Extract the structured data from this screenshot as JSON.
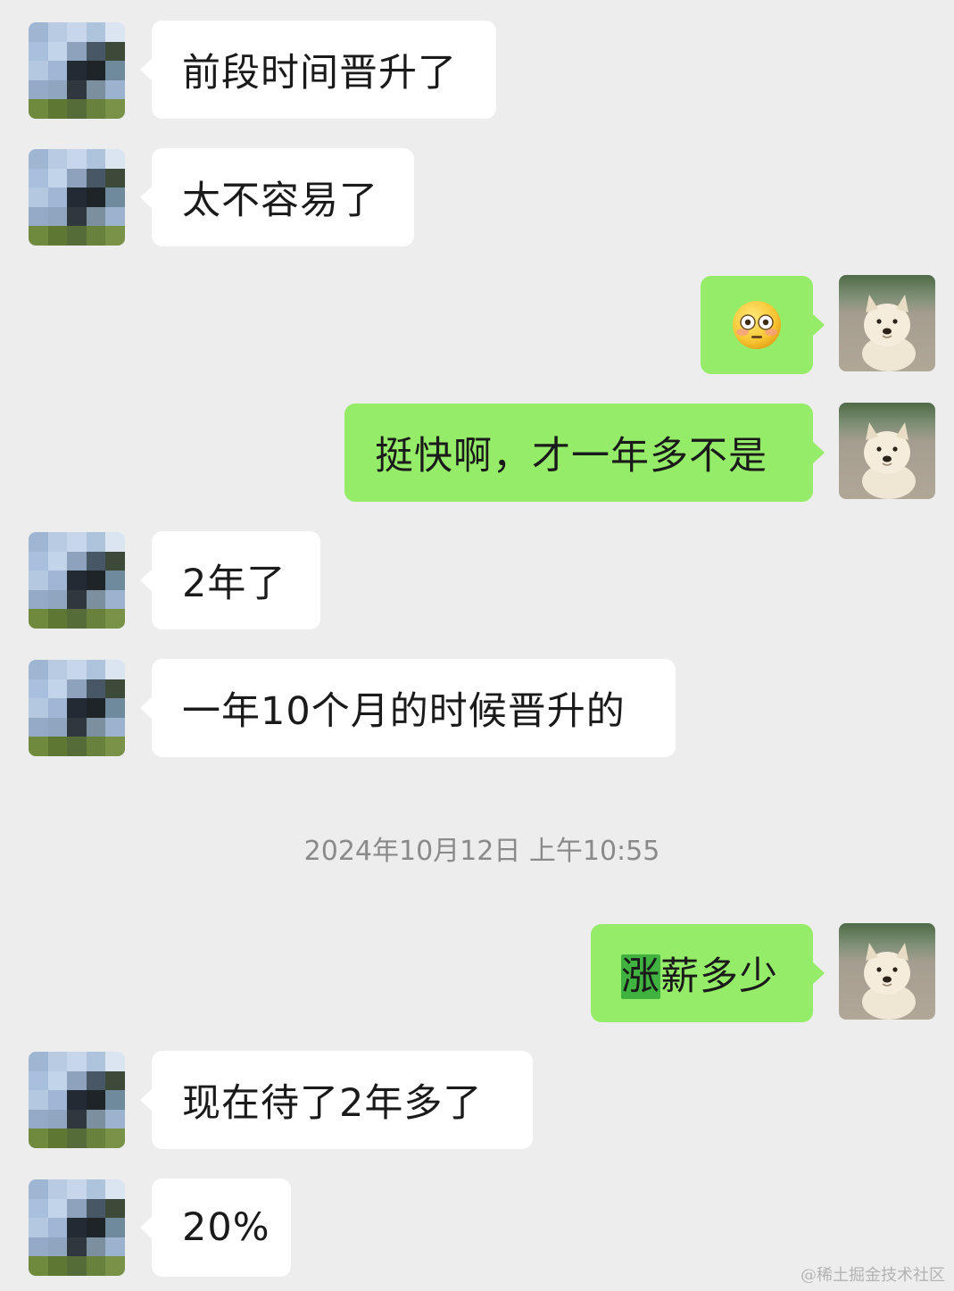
{
  "chat": {
    "messages": [
      {
        "side": "left",
        "text": "前段时间晋升了"
      },
      {
        "side": "left",
        "text": "太不容易了"
      },
      {
        "side": "right",
        "emoji": "flushed-face"
      },
      {
        "side": "right",
        "text": "挺快啊，才一年多不是"
      },
      {
        "side": "left",
        "text": "2年了"
      },
      {
        "side": "left",
        "text": "一年10个月的时候晋升的"
      },
      {
        "side": "right",
        "text_highlight": "涨",
        "text_rest": "薪多少"
      },
      {
        "side": "left",
        "text": "现在待了2年多了"
      },
      {
        "side": "left",
        "text": "20%"
      }
    ],
    "timestamp": "2024年10月12日 上午10:55"
  },
  "watermark": "@稀土掘金技术社区",
  "colors": {
    "background": "#ededed",
    "incoming_bubble": "#ffffff",
    "outgoing_bubble": "#95ec69",
    "highlight": "#3fb23f",
    "timestamp_text": "#8a8a8a"
  }
}
